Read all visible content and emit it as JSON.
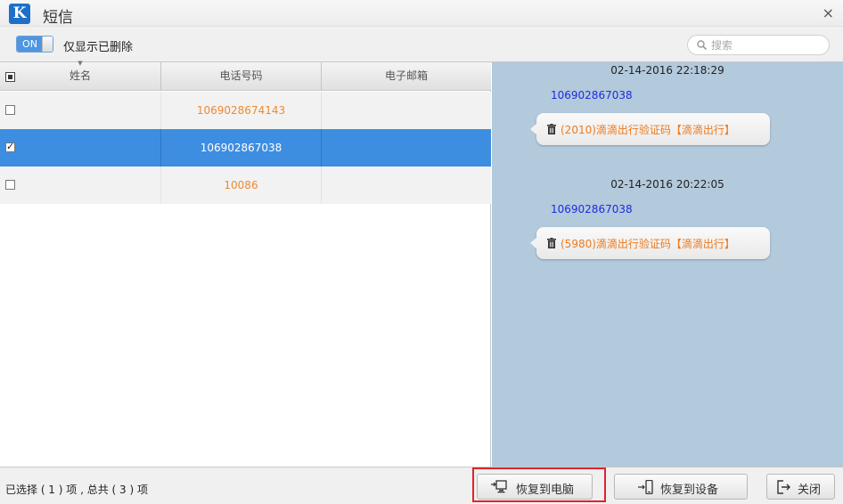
{
  "window": {
    "logo_letter": "K",
    "title": "短信",
    "close_glyph": "×"
  },
  "toolbar": {
    "toggle_state": "ON",
    "toggle_label": "仅显示已删除",
    "search_placeholder": "搜索"
  },
  "table": {
    "columns": [
      "姓名",
      "电话号码",
      "电子邮箱"
    ],
    "rows": [
      {
        "name": "",
        "phone": "1069028674143",
        "email": "",
        "checked": false,
        "selected": false
      },
      {
        "name": "",
        "phone": "106902867038",
        "email": "",
        "checked": true,
        "selected": true
      },
      {
        "name": "",
        "phone": "10086",
        "email": "",
        "checked": false,
        "selected": false
      }
    ]
  },
  "messages": [
    {
      "time": "02-14-2016 22:18:29",
      "number": "106902867038",
      "text": "(2010)滴滴出行验证码【滴滴出行】"
    },
    {
      "time": "02-14-2016 20:22:05",
      "number": "106902867038",
      "text": "(5980)滴滴出行验证码【滴滴出行】"
    }
  ],
  "status": {
    "text": "已选择 ( 1 ) 项 , 总共 ( 3 ) 项"
  },
  "buttons": {
    "restore_to_pc": "恢复到电脑",
    "restore_to_device": "恢复到设备",
    "close": "关闭"
  },
  "colors": {
    "accent_blue": "#3d8ee0",
    "phone_orange": "#ee8a2e",
    "message_panel": "#b3c9dc",
    "highlight_red": "#e0242a"
  }
}
